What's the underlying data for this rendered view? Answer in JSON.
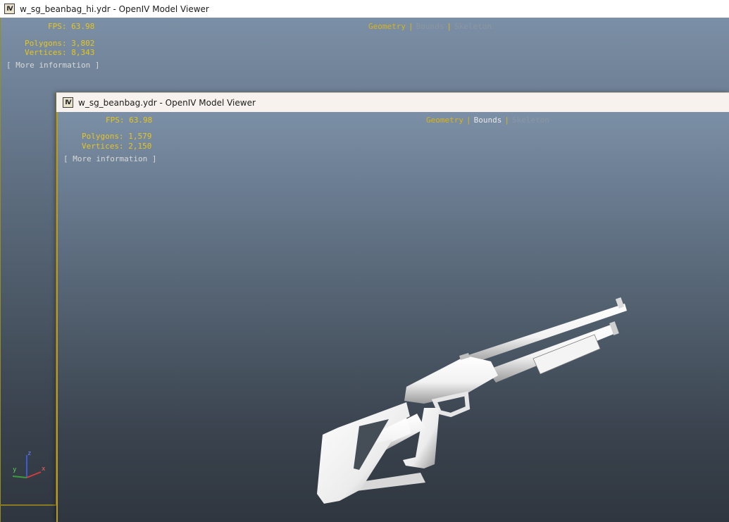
{
  "back_window": {
    "title": "w_sg_beanbag_hi.ydr - OpenIV Model Viewer",
    "app_icon": "IV",
    "fps": "FPS: 63.98",
    "polygons": "Polygons: 3,802",
    "vertices": "Vertices: 8,343",
    "more_info": "[ More information ]",
    "modes": {
      "geometry": "Geometry",
      "bounds": "Bounds",
      "skeleton": "Skeleton",
      "separator": "|"
    },
    "axis": {
      "z": "z",
      "y": "y",
      "x": "x"
    }
  },
  "front_window": {
    "title": "w_sg_beanbag.ydr - OpenIV Model Viewer",
    "app_icon": "IV",
    "fps": "FPS: 63.98",
    "polygons": "Polygons: 1,579",
    "vertices": "Vertices: 2,150",
    "more_info": "[ More information ]",
    "modes": {
      "geometry": "Geometry",
      "bounds": "Bounds",
      "skeleton": "Skeleton",
      "separator": "|"
    },
    "model": "shotgun-model"
  },
  "colors": {
    "stat_text": "#e6c619",
    "active_mode": "#d9b416",
    "viewport_top": "#7b8fa6",
    "viewport_bottom": "#2f363f"
  }
}
